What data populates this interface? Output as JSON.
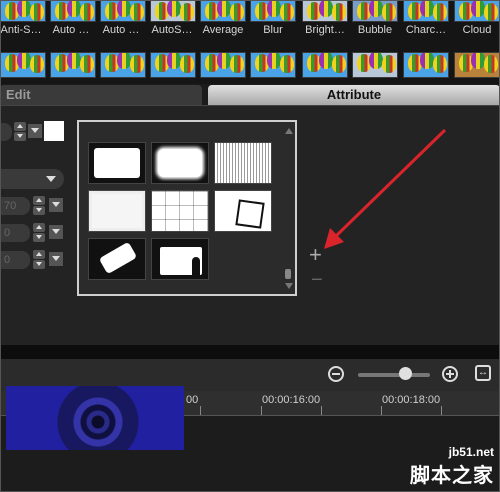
{
  "effects": {
    "labels": [
      "Anti-S…",
      "Auto …",
      "Auto …",
      "AutoS…",
      "Average",
      "Blur",
      "Bright…",
      "Bubble",
      "Charc…",
      "Cloud"
    ]
  },
  "tabs": {
    "edit": "Edit",
    "attribute": "Attribute"
  },
  "fields": {
    "value1": "70",
    "value2": "0",
    "value3": "0"
  },
  "timeline": {
    "ticks": [
      "00",
      "00:00:16:00",
      "00:00:18:00"
    ],
    "zoom_level": 0.66
  },
  "colors": {
    "arrow": "#d9242b",
    "panel": "#232323",
    "clip": "#2a2a8a"
  },
  "watermark": {
    "site": "jb51.net",
    "cn": "脚本之家"
  }
}
